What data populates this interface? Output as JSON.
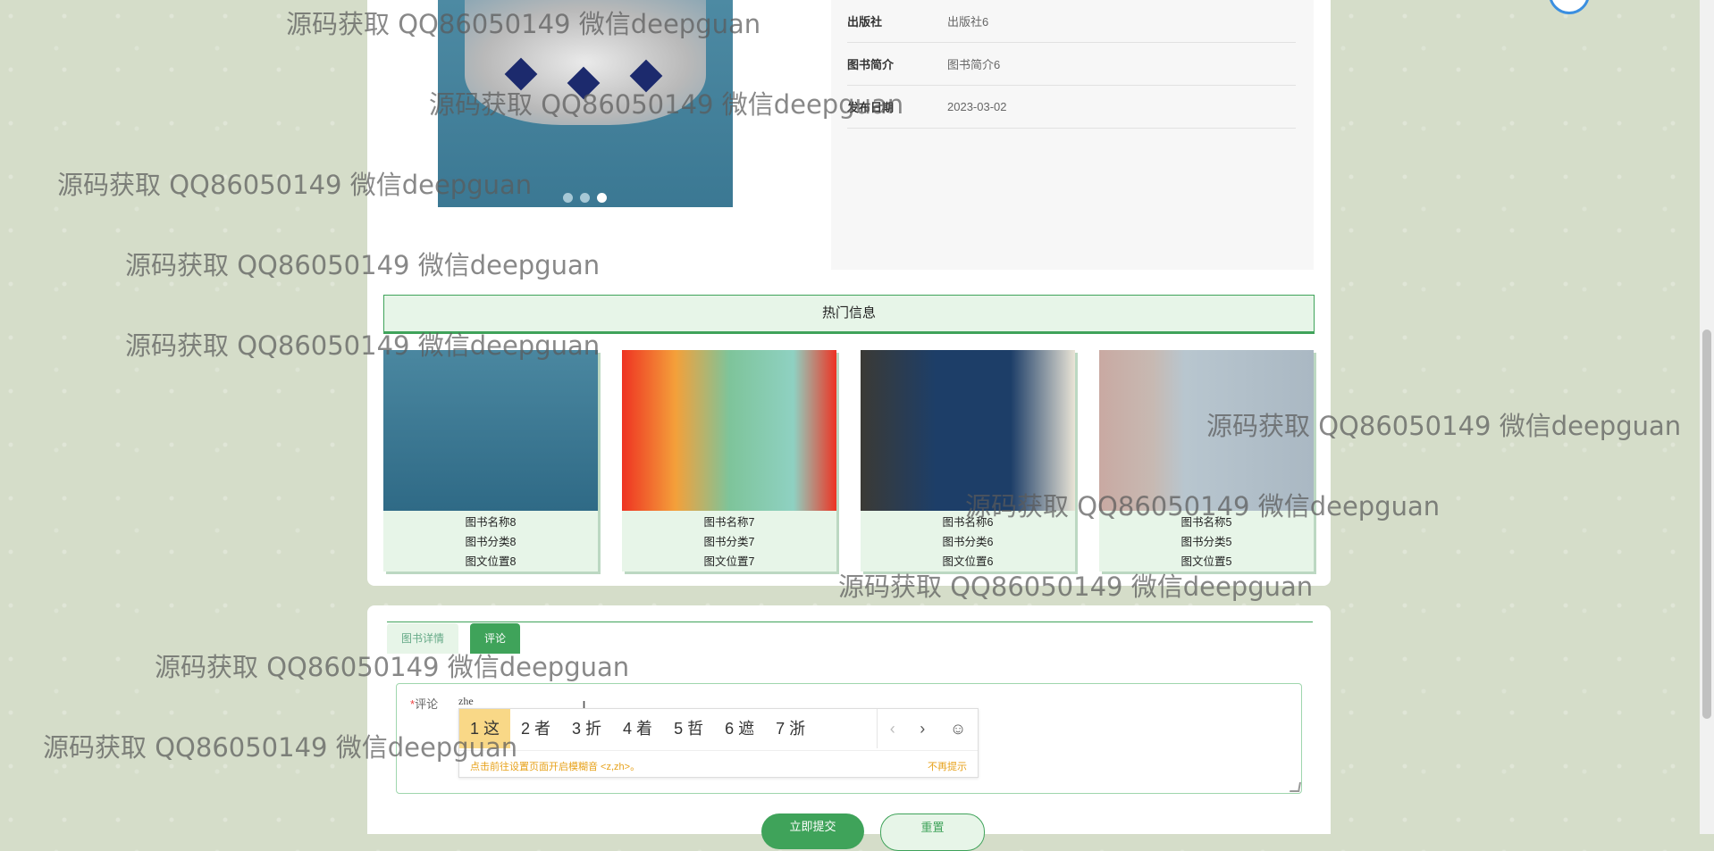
{
  "book_info": [
    {
      "label": "出版社",
      "value": "出版社6"
    },
    {
      "label": "图书简介",
      "value": "图书简介6"
    },
    {
      "label": "发布日期",
      "value": "2023-03-02"
    }
  ],
  "hot": {
    "title": "热门信息",
    "cards": [
      {
        "name": "图书名称8",
        "category": "图书分类8",
        "location": "图文位置8"
      },
      {
        "name": "图书名称7",
        "category": "图书分类7",
        "location": "图文位置7"
      },
      {
        "name": "图书名称6",
        "category": "图书分类6",
        "location": "图文位置6"
      },
      {
        "name": "图书名称5",
        "category": "图书分类5",
        "location": "图文位置5"
      }
    ]
  },
  "tabs": {
    "details": "图书详情",
    "comments": "评论"
  },
  "comment": {
    "label": "评论",
    "required_mark": "*",
    "typed_text": "zhe"
  },
  "ime": {
    "candidates": [
      "1 这",
      "2 者",
      "3 折",
      "4 着",
      "5 哲",
      "6 遮",
      "7 浙"
    ],
    "prev": "‹",
    "next": "›",
    "emoji": "☺",
    "hint": "点击前往设置页面开启模糊音 <z,zh>。",
    "dismiss": "不再提示"
  },
  "buttons": {
    "submit": "立即提交",
    "reset": "重置"
  },
  "watermark": "源码获取 QQ86050149 微信deepguan",
  "colors": {
    "accent": "#3fa35a",
    "accent_light": "#e7f5e8",
    "ime_selected": "#f9d887"
  }
}
